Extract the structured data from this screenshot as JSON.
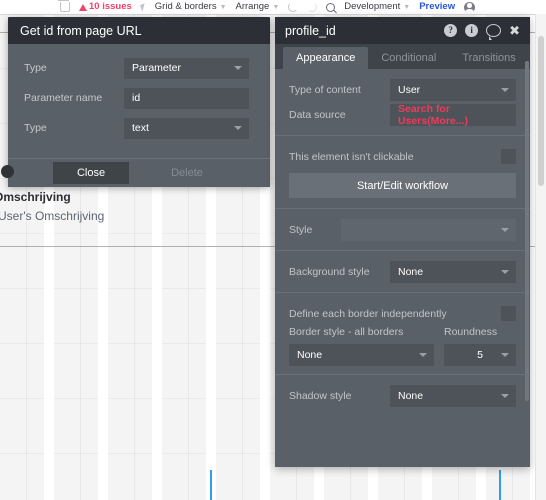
{
  "toolbar": {
    "items": [
      {
        "name": "trash",
        "label": "",
        "icon": "trash-icon"
      },
      {
        "name": "issues",
        "label": "10 issues",
        "icon": "warning-triangle-icon"
      },
      {
        "name": "pointer",
        "label": "",
        "icon": "cursor-arrow-icon"
      },
      {
        "name": "grid",
        "label": "Grid & borders",
        "icon": "chevron-down-icon"
      },
      {
        "name": "arrange",
        "label": "Arrange",
        "icon": "chevron-down-icon"
      },
      {
        "name": "undo",
        "label": "",
        "icon": "undo-icon"
      },
      {
        "name": "redo",
        "label": "",
        "icon": "redo-icon"
      },
      {
        "name": "search",
        "label": "",
        "icon": "search-icon"
      },
      {
        "name": "development",
        "label": "Development",
        "icon": "chevron-down-icon"
      },
      {
        "name": "preview",
        "label": "Preview",
        "icon": ""
      },
      {
        "name": "account",
        "label": "",
        "icon": "avatar-icon"
      }
    ],
    "issues_label": "10 issues",
    "grid_label": "Grid & borders",
    "arrange_label": "Arrange",
    "development_label": "Development",
    "preview_label": "Preview"
  },
  "canvas": {
    "heading_text": "Omschrijving",
    "value_text": "User's Omschrijving"
  },
  "dialog": {
    "title": "Get id from page URL",
    "rows": [
      {
        "label": "Type",
        "value": "Parameter",
        "control": "dropdown"
      },
      {
        "label": "Parameter name",
        "value": "id",
        "control": "text"
      },
      {
        "label": "Type",
        "value": "text",
        "control": "dropdown"
      }
    ],
    "close_label": "Close",
    "delete_label": "Delete"
  },
  "properties": {
    "title": "profile_id",
    "title_icons": [
      {
        "name": "help-icon",
        "glyph": "?"
      },
      {
        "name": "info-icon",
        "glyph": "i"
      },
      {
        "name": "comment-icon",
        "glyph": ""
      },
      {
        "name": "close-icon",
        "glyph": "✖"
      }
    ],
    "help_glyph": "?",
    "info_glyph": "i",
    "close_glyph": "✖",
    "tabs": [
      {
        "label": "Appearance",
        "active": true
      },
      {
        "label": "Conditional",
        "active": false
      },
      {
        "label": "Transitions",
        "active": false
      }
    ],
    "content_type_label": "Type of content",
    "content_type_value": "User",
    "data_source_label": "Data source",
    "data_source_value": "Search for Users(More...)",
    "data_source_color": "#ee3b5b",
    "clickable_label": "This element isn't clickable",
    "workflow_button_label": "Start/Edit workflow",
    "style_label": "Style",
    "style_value": "",
    "background_style_label": "Background style",
    "background_style_value": "None",
    "define_borders_label": "Define each border independently",
    "border_style_label": "Border style - all borders",
    "border_style_value": "None",
    "roundness_label": "Roundness",
    "roundness_value": "5",
    "shadow_style_label": "Shadow style",
    "shadow_style_value": "None"
  },
  "colors": {
    "panel_bg": "#5a6068",
    "title_bg": "#2c3036",
    "field_bg": "#4e5359",
    "accent_red": "#ee3b5b",
    "accent_blue": "#2b56d6",
    "guide_blue": "#2e9fe8"
  }
}
